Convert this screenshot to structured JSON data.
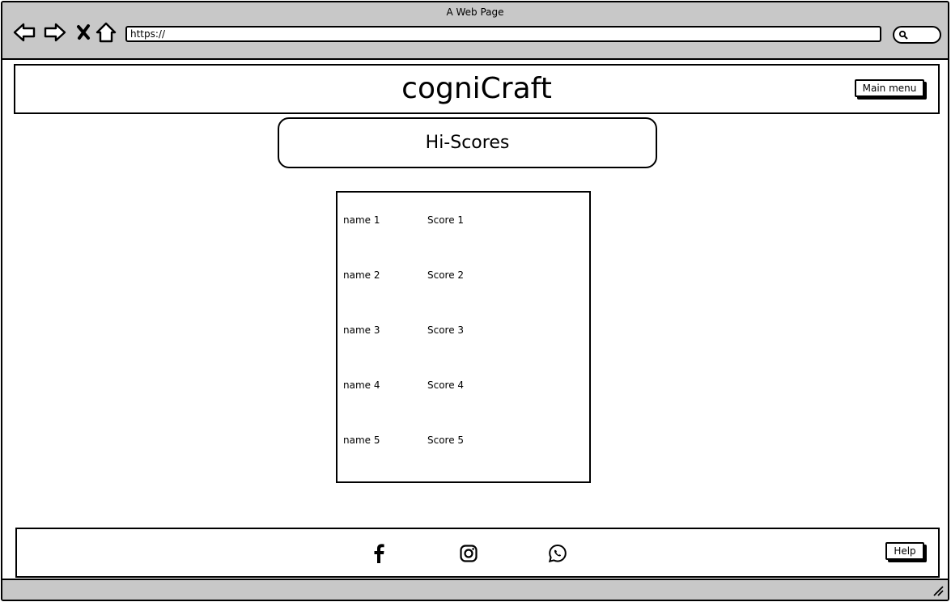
{
  "window": {
    "title": "A Web Page"
  },
  "browser": {
    "url": "https://",
    "icons": [
      "back-arrow-icon",
      "forward-arrow-icon",
      "close-x-icon",
      "home-icon",
      "search-icon"
    ]
  },
  "header": {
    "brand": "cogniCraft",
    "menu_button": "Main menu"
  },
  "section": {
    "title": "Hi-Scores"
  },
  "scores": [
    {
      "name": "name 1",
      "score": "Score 1"
    },
    {
      "name": "name 2",
      "score": "Score 2"
    },
    {
      "name": "name 3",
      "score": "Score 3"
    },
    {
      "name": "name 4",
      "score": "Score 4"
    },
    {
      "name": "name 5",
      "score": "Score 5"
    }
  ],
  "footer": {
    "social_icons": [
      "facebook-icon",
      "instagram-icon",
      "whatsapp-icon"
    ],
    "help_button": "Help"
  },
  "colors": {
    "chrome": "#c8c8c8",
    "ink": "#000000",
    "background": "#ffffff"
  }
}
